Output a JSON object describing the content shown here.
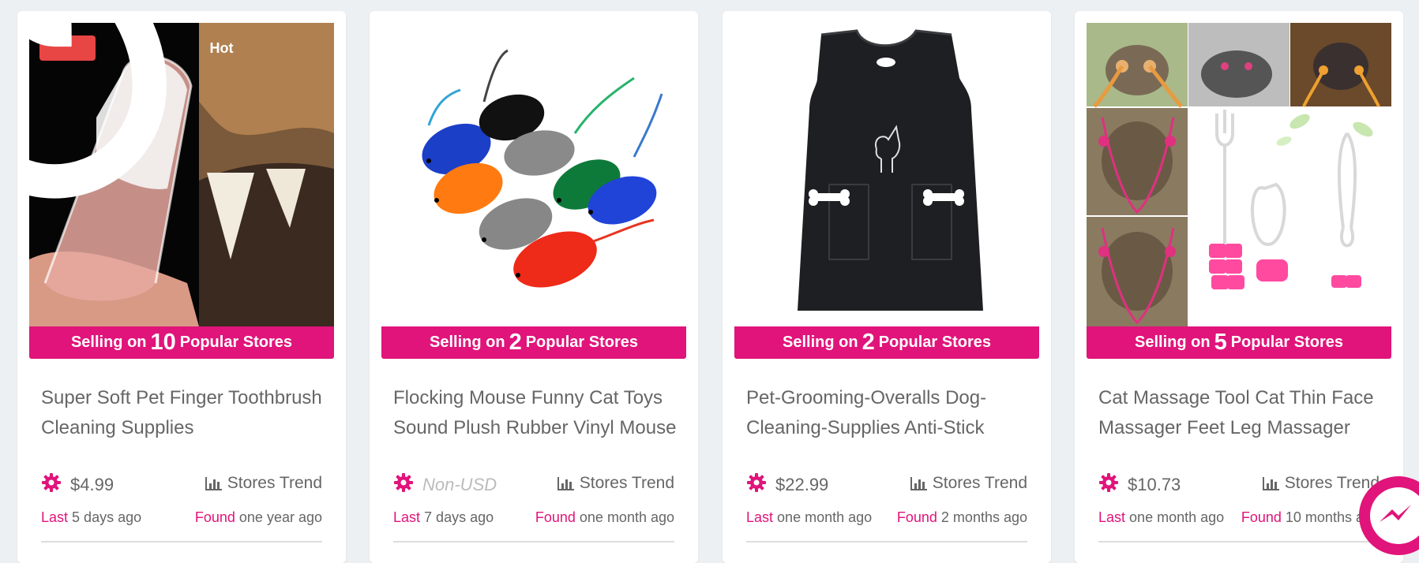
{
  "products": [
    {
      "badge": "Hot",
      "selling_prefix": "Selling on",
      "selling_count": "10",
      "selling_suffix": "Popular Stores",
      "title": "Super Soft Pet Finger Toothbrush Cleaning Supplies",
      "price": "$4.99",
      "trend_label": "Stores Trend",
      "last_label": "Last",
      "last_value": "5 days ago",
      "found_label": "Found",
      "found_value": "one year ago"
    },
    {
      "selling_prefix": "Selling on",
      "selling_count": "2",
      "selling_suffix": "Popular Stores",
      "title": "Flocking Mouse Funny Cat Toys Sound Plush Rubber Vinyl Mouse",
      "price": "Non-USD",
      "trend_label": "Stores Trend",
      "last_label": "Last",
      "last_value": "7 days ago",
      "found_label": "Found",
      "found_value": "one month ago"
    },
    {
      "selling_prefix": "Selling on",
      "selling_count": "2",
      "selling_suffix": "Popular Stores",
      "title": "Pet-Grooming-Overalls Dog-Cleaning-Supplies Anti-Stick",
      "price": "$22.99",
      "trend_label": "Stores Trend",
      "last_label": "Last",
      "last_value": "one month ago",
      "found_label": "Found",
      "found_value": "2 months ago"
    },
    {
      "selling_prefix": "Selling on",
      "selling_count": "5",
      "selling_suffix": "Popular Stores",
      "title": "Cat Massage Tool Cat Thin Face Massager Feet Leg Massager",
      "price": "$10.73",
      "trend_label": "Stores Trend",
      "last_label": "Last",
      "last_value": "one month ago",
      "found_label": "Found",
      "found_value": "10 months ago"
    }
  ],
  "colors": {
    "accent": "#e0147a",
    "hot_badge": "#e84545",
    "text": "#666666",
    "background": "#edf0f3"
  },
  "icons": [
    "fire-icon",
    "gear-icon",
    "bar-chart-icon",
    "messenger-icon"
  ]
}
